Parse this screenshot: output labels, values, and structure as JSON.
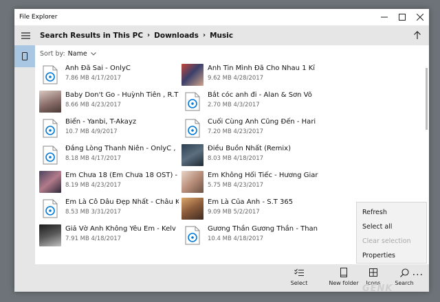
{
  "window": {
    "title": "File Explorer"
  },
  "breadcrumb": [
    "Search Results in This PC",
    "Downloads",
    "Music"
  ],
  "sort": {
    "label": "Sort by:",
    "value": "Name"
  },
  "files": [
    {
      "name": "Anh Đã Sai - OnlyC",
      "meta": "7.86 MB  4/17/2017",
      "thumb": "file",
      "col": 0
    },
    {
      "name": "Anh Tin Mình Đã Cho Nhau 1 Kỉ",
      "meta": "9.62 MB  4/28/2017",
      "thumb": "photo-a",
      "col": 1
    },
    {
      "name": "Baby Don't Go - Huỳnh Tiên , R.T",
      "meta": "8.66 MB  4/23/2017",
      "thumb": "photo-b",
      "col": 0
    },
    {
      "name": "Bắt cóc anh đi - Alan & Sơn Võ",
      "meta": "2.70 MB  4/3/2017",
      "thumb": "file",
      "col": 1
    },
    {
      "name": "Biển - Yanbi, T-Akayz",
      "meta": "10.7 MB  4/9/2017",
      "thumb": "file",
      "col": 0
    },
    {
      "name": "Cuối Cùng Anh Cũng Đến - Hari",
      "meta": "7.20 MB  4/23/2017",
      "thumb": "file",
      "col": 1
    },
    {
      "name": "Đắng Lòng Thanh Niên - OnlyC ,",
      "meta": "8.18 MB  4/17/2017",
      "thumb": "file",
      "col": 0
    },
    {
      "name": "Điều Buồn Nhất (Remix)",
      "meta": "8.03 MB  4/18/2017",
      "thumb": "photo-c",
      "col": 1
    },
    {
      "name": "Em Chưa 18 (Em Chưa 18 OST) - V",
      "meta": "8.19 MB  4/23/2017",
      "thumb": "photo-d",
      "col": 0
    },
    {
      "name": "Em Không Hối Tiếc - Hương Giar",
      "meta": "5.75 MB  4/23/2017",
      "thumb": "photo-e",
      "col": 1
    },
    {
      "name": "Em Là Cô Dâu Đẹp Nhất - Châu K",
      "meta": "8.53 MB  3/31/2017",
      "thumb": "file",
      "col": 0
    },
    {
      "name": "Em Là Của Anh - S.T 365",
      "meta": "9.09 MB  5/2/2017",
      "thumb": "photo-f",
      "col": 1
    },
    {
      "name": "Giả Vờ Anh Không Yêu Em - Kelv",
      "meta": "7.91 MB  4/18/2017",
      "thumb": "photo-g",
      "col": 0
    },
    {
      "name": "Gương Thần Gương Thần - Than",
      "meta": "10.4 MB  4/18/2017",
      "thumb": "file",
      "col": 1
    }
  ],
  "context_menu": [
    {
      "label": "Refresh",
      "enabled": true
    },
    {
      "label": "Select all",
      "enabled": true
    },
    {
      "label": "Clear selection",
      "enabled": false
    },
    {
      "label": "Properties",
      "enabled": true
    }
  ],
  "commands": [
    {
      "label": "Select",
      "icon": "select-icon"
    },
    {
      "label": "New folder",
      "icon": "new-folder-icon"
    },
    {
      "label": "Icons",
      "icon": "grid-view-icon"
    },
    {
      "label": "Search",
      "icon": "search-icon"
    }
  ],
  "watermark": "GENK",
  "colors": {
    "accent": "#0078d7",
    "sidebar_selected": "#a9c6e3",
    "chrome": "#e6e6e6"
  }
}
